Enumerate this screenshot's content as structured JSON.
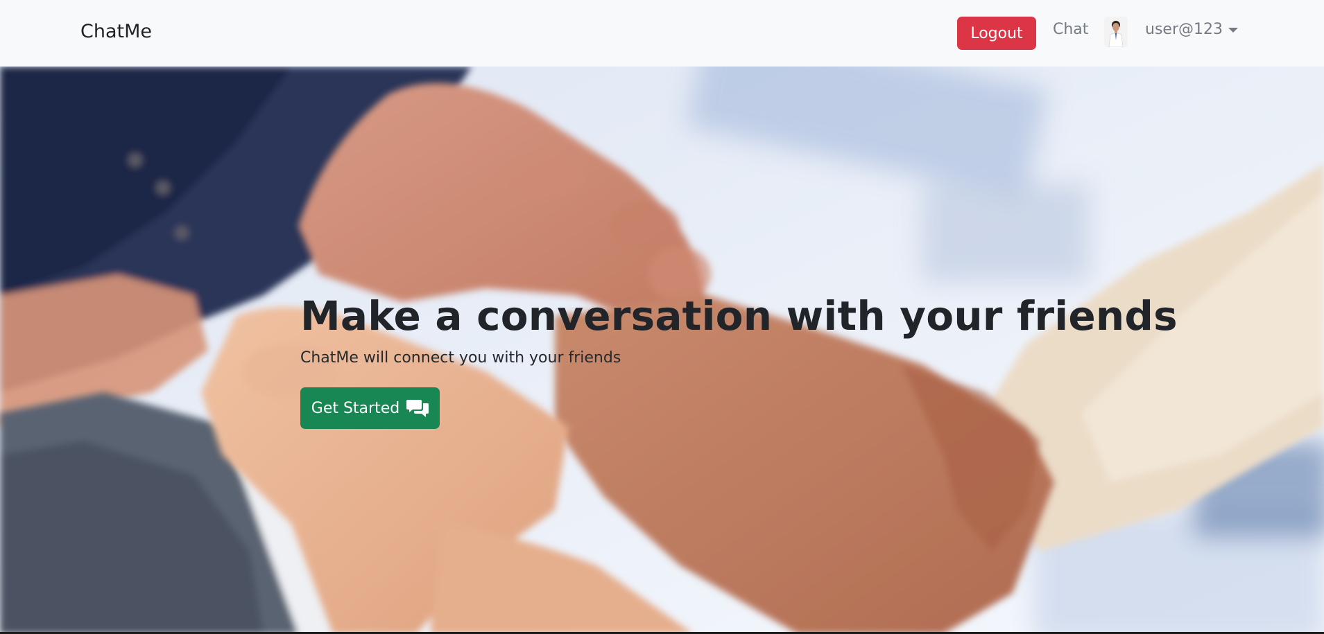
{
  "navbar": {
    "brand": "ChatMe",
    "logout_label": "Logout",
    "chat_link": "Chat",
    "avatar_icon": "user-avatar",
    "user_label": "user@123"
  },
  "hero": {
    "title": "Make a conversation with your friends",
    "subtitle": "ChatMe will connect you with your friends",
    "cta_label": "Get Started",
    "cta_icon": "chat-bubbles-icon"
  },
  "colors": {
    "navbar_bg": "#f8f9fa",
    "logout": "#dc3545",
    "cta": "#198754",
    "title": "#212529"
  }
}
